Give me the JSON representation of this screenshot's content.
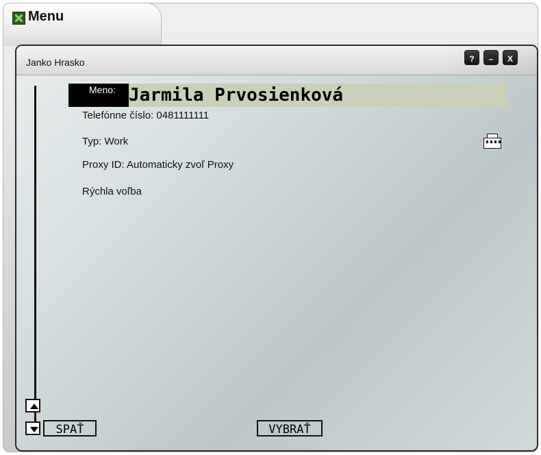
{
  "menu_tab": {
    "title": "Menu"
  },
  "window": {
    "user_name": "Janko Hrasko",
    "buttons": {
      "help": "?",
      "minimize": "–",
      "close": "X"
    }
  },
  "contact": {
    "name_label": "Meno:",
    "name_value": "Jarmila Prvosienková",
    "phone": "Telefónne číslo: 0481111111",
    "type": "Typ: Work",
    "proxy": "Proxy ID: Automaticky zvoľ Proxy",
    "speed_dial": "Rýchla voľba",
    "type_icon": "factory-icon"
  },
  "softkeys": {
    "back": "SPAŤ",
    "select": "VYBRAŤ"
  },
  "colors": {
    "name_highlight": "#c9d0b7",
    "window_bg": "#d3dcdd",
    "frame_dark": "#2b2b2b"
  }
}
